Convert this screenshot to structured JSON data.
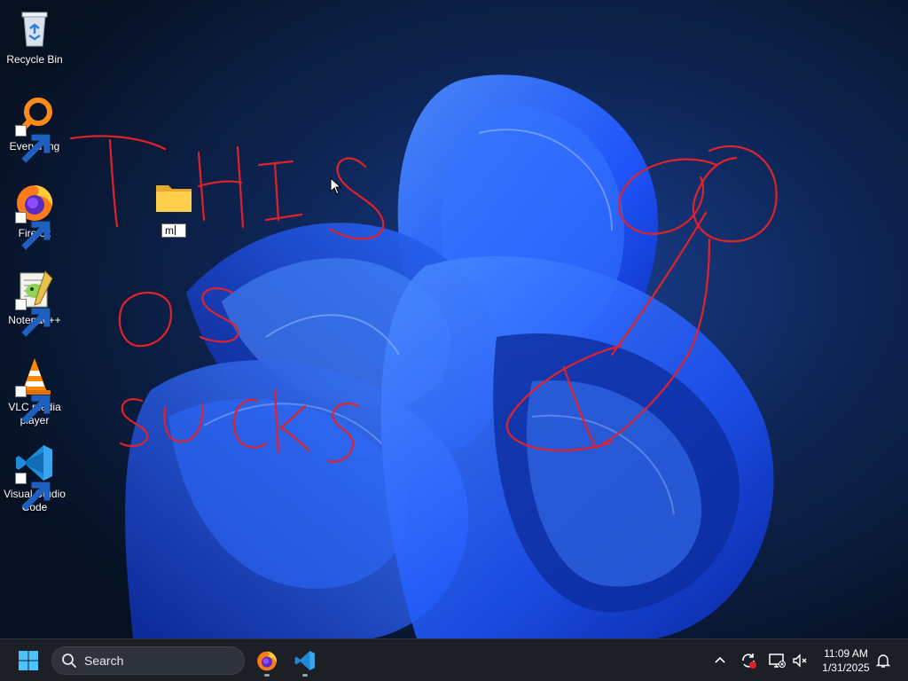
{
  "desktop": {
    "icons": [
      {
        "label": "Recycle Bin"
      },
      {
        "label": "Everything"
      },
      {
        "label": "Firefox"
      },
      {
        "label": "Notepad++"
      },
      {
        "label": "VLC media player"
      },
      {
        "label": "Visual Studio Code"
      }
    ],
    "new_folder": {
      "rename_value": "m"
    },
    "handwriting": "THIS OS SUCKS"
  },
  "taskbar": {
    "search_label": "Search",
    "pinned": [
      {
        "name": "Firefox",
        "icon": "firefox-icon"
      },
      {
        "name": "Visual Studio Code",
        "icon": "vscode-icon"
      }
    ],
    "tray": {
      "time": "11:09 AM",
      "date": "1/31/2025"
    }
  },
  "colors": {
    "taskbar_bg": "#1c1f26",
    "scribble": "#e0222a",
    "wallpaper_blue": "#1e5cff",
    "start_blue": "#4cc2ff"
  }
}
